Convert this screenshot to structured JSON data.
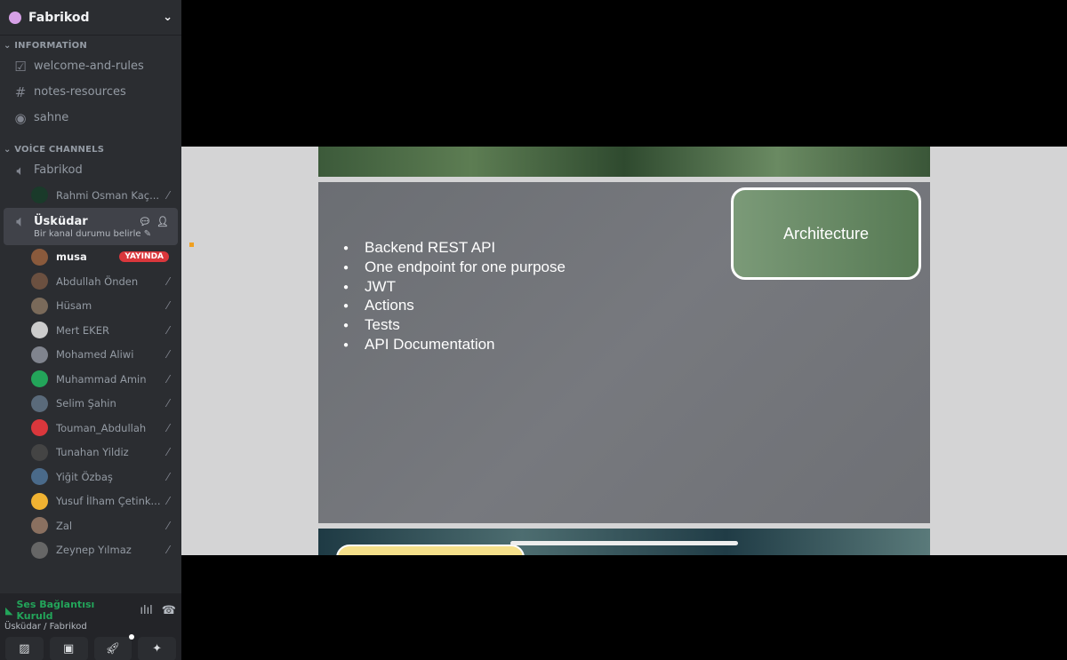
{
  "server": {
    "name": "Fabrikod"
  },
  "categories": [
    {
      "label": "INFORMATİON"
    },
    {
      "label": "VOİCE CHANNELS"
    }
  ],
  "text_channels": [
    {
      "label": "welcome-and-rules",
      "icon": "rules-icon"
    },
    {
      "label": "notes-resources",
      "icon": "hash-lock-icon"
    },
    {
      "label": "sahne",
      "icon": "stage-icon"
    }
  ],
  "voice": {
    "fabrikod": {
      "label": "Fabrikod",
      "members": [
        {
          "name": "Rahmi Osman Kaç..."
        }
      ]
    },
    "uskudar": {
      "label": "Üsküdar",
      "status": "Bir kanal durumu belirle",
      "members": [
        {
          "name": "musa",
          "badge": "YAYINDA",
          "color": "#8a5a3c"
        },
        {
          "name": "Abdullah Önden",
          "color": "#6b5040"
        },
        {
          "name": "Hüsam",
          "color": "#7a6a5a"
        },
        {
          "name": "Mert EKER",
          "color": "#ccc"
        },
        {
          "name": "Mohamed Aliwi",
          "color": "#80848e"
        },
        {
          "name": "Muhammad Amin",
          "color": "#23a55a"
        },
        {
          "name": "Selim Şahin",
          "color": "#5a6a7a"
        },
        {
          "name": "Touman_Abdullah",
          "color": "#da373c"
        },
        {
          "name": "Tunahan Yildiz",
          "color": "#444"
        },
        {
          "name": "Yiğit Özbaş",
          "color": "#4a6a8a"
        },
        {
          "name": "Yusuf İlham Çetink...",
          "color": "#f0b232"
        },
        {
          "name": "Zal",
          "color": "#8a7060"
        },
        {
          "name": "Zeynep Yılmaz",
          "color": "#666"
        }
      ]
    }
  },
  "panel": {
    "status": "Ses Bağlantısı Kuruld",
    "location": "Üsküdar / Fabrikod"
  },
  "slide": {
    "title": "Architecture",
    "bullets": [
      "Backend REST API",
      "One endpoint for one purpose",
      "JWT",
      "Actions",
      "Tests",
      "API Documentation"
    ]
  }
}
